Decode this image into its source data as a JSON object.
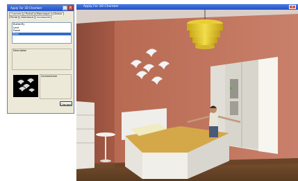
{
  "panel": {
    "title": "Apply For 3D Chamber",
    "tabs_row1": [
      "Chamber",
      "Portail",
      "Mannequin",
      "Statue"
    ],
    "tabs_row2": [
      "Portal",
      "Ambiance",
      "Accessoire"
    ],
    "list_items": [
      "Butterfly",
      "Leaf",
      "Swan",
      "Bird"
    ],
    "selected_index": 3,
    "description_label": "Description",
    "comments_label": "Commentaire",
    "change_button": "Changer"
  },
  "view": {
    "title": "Apply For 3D Chamber"
  }
}
